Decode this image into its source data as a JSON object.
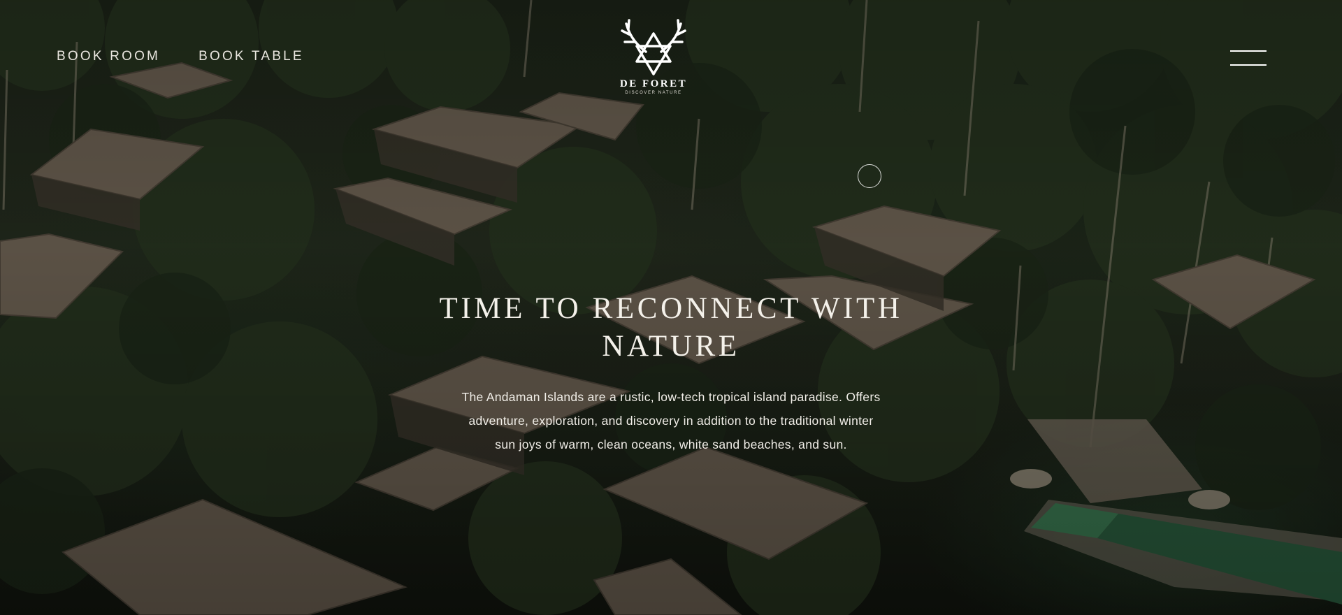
{
  "nav": {
    "book_room": "BOOK ROOM",
    "book_table": "BOOK TABLE"
  },
  "logo": {
    "name": "DE FORET",
    "tagline": "DISCOVER NATURE",
    "icon": "antler-triangle-logo"
  },
  "menu": {
    "icon": "hamburger-menu-icon"
  },
  "hero": {
    "title": "TIME TO RECONNECT WITH NATURE",
    "text": "The Andaman Islands are a rustic, low-tech tropical island paradise. Offers adventure, exploration, and discovery in addition to the traditional winter sun joys of warm, clean oceans, white sand beaches, and sun.",
    "background": "aerial view of forest resort with cabins and pool"
  },
  "colors": {
    "text": "#ffffff",
    "forest_dark": "#1c2418",
    "roof": "#6b5e4f",
    "pool": "#2f6a45"
  }
}
